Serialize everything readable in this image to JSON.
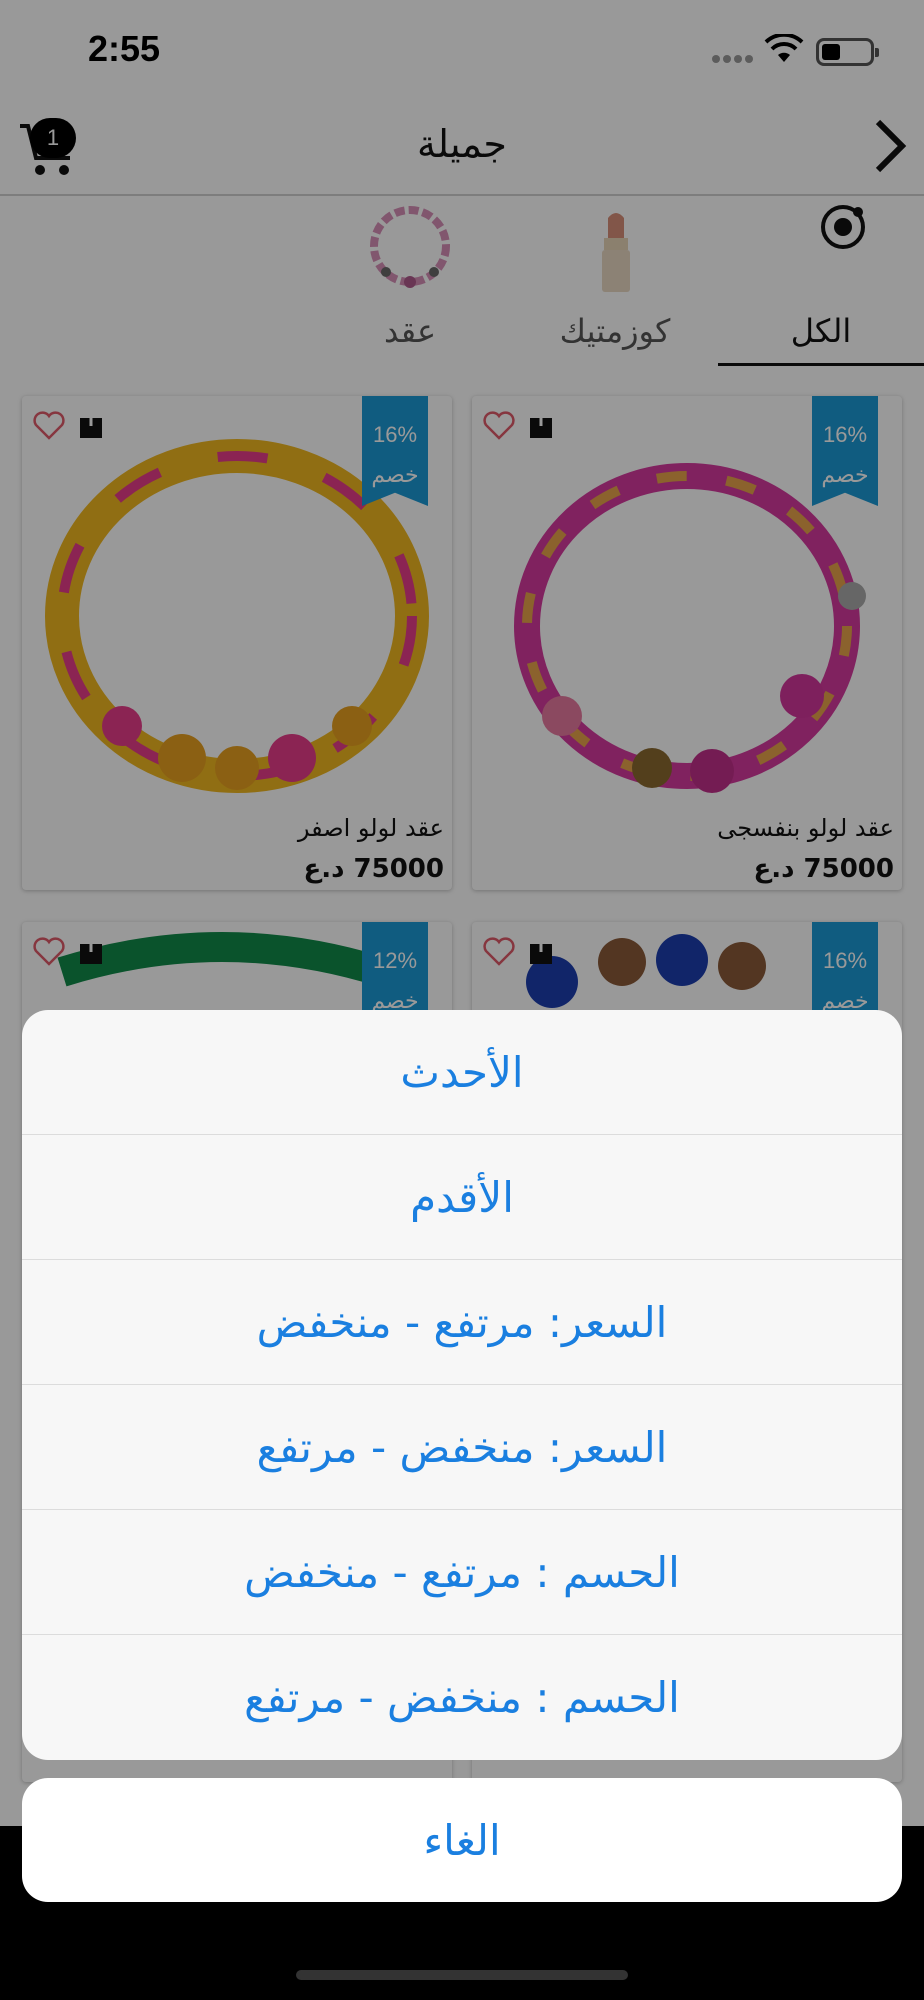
{
  "status_bar": {
    "time": "2:55"
  },
  "nav": {
    "title": "جميلة",
    "cart_count": "1"
  },
  "tabs": [
    {
      "label": "الكل"
    },
    {
      "label": "كوزمتيك"
    },
    {
      "label": "عقد"
    }
  ],
  "products": [
    {
      "name": "عقد لولو بنفسجى",
      "price": "75000 د.ع",
      "discount": "16%",
      "discount_label": "خصم"
    },
    {
      "name": "عقد لولو اصفر",
      "price": "75000 د.ع",
      "discount": "16%",
      "discount_label": "خصم"
    },
    {
      "name": "",
      "price": "",
      "discount": "16%",
      "discount_label": "خصم"
    },
    {
      "name": "",
      "price": "",
      "discount": "12%",
      "discount_label": "خصم"
    }
  ],
  "sort_sheet": {
    "options": [
      "الأحدث",
      "الأقدم",
      "السعر: مرتفع - منخفض",
      "السعر: منخفض - مرتفع",
      "الحسم : مرتفع - منخفض",
      "الحسم : منخفض - مرتفع"
    ],
    "cancel": "الغاء"
  },
  "colors": {
    "accent": "#1a7fe0",
    "ribbon": "#1c9ad6"
  }
}
